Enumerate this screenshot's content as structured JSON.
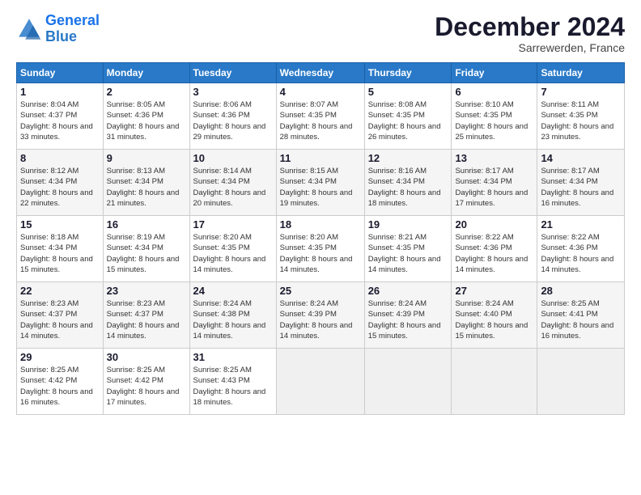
{
  "logo": {
    "line1": "General",
    "line2": "Blue"
  },
  "title": "December 2024",
  "subtitle": "Sarrewerden, France",
  "header_days": [
    "Sunday",
    "Monday",
    "Tuesday",
    "Wednesday",
    "Thursday",
    "Friday",
    "Saturday"
  ],
  "weeks": [
    [
      {
        "day": "1",
        "sunrise": "8:04 AM",
        "sunset": "4:37 PM",
        "daylight": "8 hours and 33 minutes."
      },
      {
        "day": "2",
        "sunrise": "8:05 AM",
        "sunset": "4:36 PM",
        "daylight": "8 hours and 31 minutes."
      },
      {
        "day": "3",
        "sunrise": "8:06 AM",
        "sunset": "4:36 PM",
        "daylight": "8 hours and 29 minutes."
      },
      {
        "day": "4",
        "sunrise": "8:07 AM",
        "sunset": "4:35 PM",
        "daylight": "8 hours and 28 minutes."
      },
      {
        "day": "5",
        "sunrise": "8:08 AM",
        "sunset": "4:35 PM",
        "daylight": "8 hours and 26 minutes."
      },
      {
        "day": "6",
        "sunrise": "8:10 AM",
        "sunset": "4:35 PM",
        "daylight": "8 hours and 25 minutes."
      },
      {
        "day": "7",
        "sunrise": "8:11 AM",
        "sunset": "4:35 PM",
        "daylight": "8 hours and 23 minutes."
      }
    ],
    [
      {
        "day": "8",
        "sunrise": "8:12 AM",
        "sunset": "4:34 PM",
        "daylight": "8 hours and 22 minutes."
      },
      {
        "day": "9",
        "sunrise": "8:13 AM",
        "sunset": "4:34 PM",
        "daylight": "8 hours and 21 minutes."
      },
      {
        "day": "10",
        "sunrise": "8:14 AM",
        "sunset": "4:34 PM",
        "daylight": "8 hours and 20 minutes."
      },
      {
        "day": "11",
        "sunrise": "8:15 AM",
        "sunset": "4:34 PM",
        "daylight": "8 hours and 19 minutes."
      },
      {
        "day": "12",
        "sunrise": "8:16 AM",
        "sunset": "4:34 PM",
        "daylight": "8 hours and 18 minutes."
      },
      {
        "day": "13",
        "sunrise": "8:17 AM",
        "sunset": "4:34 PM",
        "daylight": "8 hours and 17 minutes."
      },
      {
        "day": "14",
        "sunrise": "8:17 AM",
        "sunset": "4:34 PM",
        "daylight": "8 hours and 16 minutes."
      }
    ],
    [
      {
        "day": "15",
        "sunrise": "8:18 AM",
        "sunset": "4:34 PM",
        "daylight": "8 hours and 15 minutes."
      },
      {
        "day": "16",
        "sunrise": "8:19 AM",
        "sunset": "4:34 PM",
        "daylight": "8 hours and 15 minutes."
      },
      {
        "day": "17",
        "sunrise": "8:20 AM",
        "sunset": "4:35 PM",
        "daylight": "8 hours and 14 minutes."
      },
      {
        "day": "18",
        "sunrise": "8:20 AM",
        "sunset": "4:35 PM",
        "daylight": "8 hours and 14 minutes."
      },
      {
        "day": "19",
        "sunrise": "8:21 AM",
        "sunset": "4:35 PM",
        "daylight": "8 hours and 14 minutes."
      },
      {
        "day": "20",
        "sunrise": "8:22 AM",
        "sunset": "4:36 PM",
        "daylight": "8 hours and 14 minutes."
      },
      {
        "day": "21",
        "sunrise": "8:22 AM",
        "sunset": "4:36 PM",
        "daylight": "8 hours and 14 minutes."
      }
    ],
    [
      {
        "day": "22",
        "sunrise": "8:23 AM",
        "sunset": "4:37 PM",
        "daylight": "8 hours and 14 minutes."
      },
      {
        "day": "23",
        "sunrise": "8:23 AM",
        "sunset": "4:37 PM",
        "daylight": "8 hours and 14 minutes."
      },
      {
        "day": "24",
        "sunrise": "8:24 AM",
        "sunset": "4:38 PM",
        "daylight": "8 hours and 14 minutes."
      },
      {
        "day": "25",
        "sunrise": "8:24 AM",
        "sunset": "4:39 PM",
        "daylight": "8 hours and 14 minutes."
      },
      {
        "day": "26",
        "sunrise": "8:24 AM",
        "sunset": "4:39 PM",
        "daylight": "8 hours and 15 minutes."
      },
      {
        "day": "27",
        "sunrise": "8:24 AM",
        "sunset": "4:40 PM",
        "daylight": "8 hours and 15 minutes."
      },
      {
        "day": "28",
        "sunrise": "8:25 AM",
        "sunset": "4:41 PM",
        "daylight": "8 hours and 16 minutes."
      }
    ],
    [
      {
        "day": "29",
        "sunrise": "8:25 AM",
        "sunset": "4:42 PM",
        "daylight": "8 hours and 16 minutes."
      },
      {
        "day": "30",
        "sunrise": "8:25 AM",
        "sunset": "4:42 PM",
        "daylight": "8 hours and 17 minutes."
      },
      {
        "day": "31",
        "sunrise": "8:25 AM",
        "sunset": "4:43 PM",
        "daylight": "8 hours and 18 minutes."
      },
      null,
      null,
      null,
      null
    ]
  ],
  "labels": {
    "sunrise": "Sunrise: ",
    "sunset": "Sunset: ",
    "daylight": "Daylight: "
  }
}
